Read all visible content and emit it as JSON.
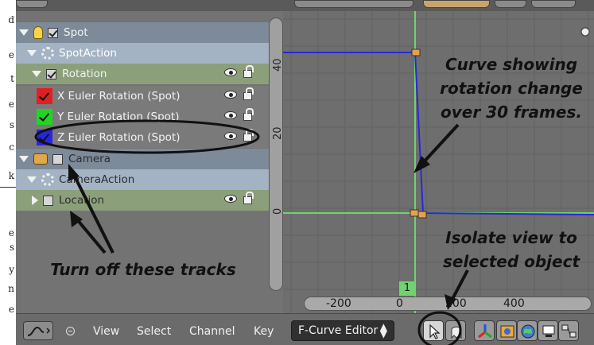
{
  "doc_margin": {
    "letters": [
      "d",
      "e",
      "t",
      "e",
      "s",
      "c",
      "k",
      "e",
      "s",
      "y",
      "n",
      "e"
    ]
  },
  "channels": [
    {
      "label": "Spot",
      "type": "object",
      "icon": "lamp-icon",
      "checked": true
    },
    {
      "label": "SpotAction",
      "type": "action",
      "icon": "action-icon"
    },
    {
      "label": "Rotation",
      "type": "group",
      "checked": true
    },
    {
      "label": "X Euler Rotation (Spot)",
      "type": "fcurve",
      "color": "#e02020"
    },
    {
      "label": "Y Euler Rotation (Spot)",
      "type": "fcurve",
      "color": "#22d522"
    },
    {
      "label": "Z Euler Rotation (Spot)",
      "type": "fcurve",
      "color": "#2626e0"
    },
    {
      "label": "Camera",
      "type": "object",
      "icon": "camera-icon",
      "checked": false
    },
    {
      "label": "CameraAction",
      "type": "action",
      "icon": "action-icon"
    },
    {
      "label": "Location",
      "type": "group",
      "checked": false
    }
  ],
  "graph": {
    "y_ticks": [
      "40",
      "20",
      "0"
    ],
    "x_ticks": [
      "-200",
      "0",
      "200",
      "400"
    ],
    "current_frame": "1",
    "curve_color": "#2929d6",
    "axis_color": "#6fd36f"
  },
  "toolbar": {
    "menus": [
      "View",
      "Select",
      "Channel",
      "Key"
    ],
    "mode": "F-Curve Editor",
    "icons": [
      "cursor-icon",
      "ghost-icon",
      "axes-icon",
      "object-icon",
      "world-icon",
      "render-icon"
    ]
  },
  "annotations": {
    "curve_note": "Curve showing rotation change over 30 frames.",
    "isolate_note": "Isolate view to selected object",
    "tracks_note": "Turn off these tracks"
  }
}
